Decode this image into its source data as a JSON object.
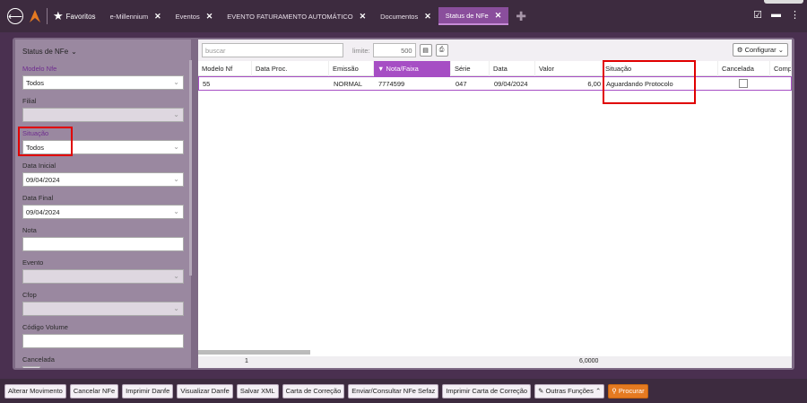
{
  "tabs": {
    "favoritos": "Favoritos",
    "items": [
      "e-Millennium",
      "Eventos",
      "EVENTO FATURAMENTO AUTOMÁTICO",
      "Documentos",
      "Status de NFe"
    ]
  },
  "side": {
    "title": "Status de NFe",
    "fields": [
      {
        "label": "Modelo Nfe",
        "value": "Todos"
      },
      {
        "label": "Filial",
        "value": ""
      },
      {
        "label": "Situação",
        "value": "Todos"
      },
      {
        "label": "Data Inicial",
        "value": "09/04/2024"
      },
      {
        "label": "Data Final",
        "value": "09/04/2024"
      },
      {
        "label": "Nota",
        "value": ""
      },
      {
        "label": "Evento",
        "value": ""
      },
      {
        "label": "Cfop",
        "value": ""
      },
      {
        "label": "Código Volume",
        "value": ""
      },
      {
        "label": "Cancelada",
        "value": ""
      }
    ]
  },
  "toolbar": {
    "search_placeholder": "buscar",
    "limit_label": "limite:",
    "limit_value": "500",
    "config": "Configurar"
  },
  "table": {
    "headers": [
      "Modelo Nf",
      "Data Proc.",
      "Emissão",
      "Nota/Faixa",
      "Série",
      "Data",
      "Valor",
      "Situação",
      "Cancelada",
      "Comp"
    ],
    "row": {
      "modelo": "55",
      "data_proc": "",
      "emissao": "NORMAL",
      "nota": "7774599",
      "serie": "047",
      "data": "09/04/2024",
      "valor": "6,00",
      "situacao": "Aguardando Protocolo"
    },
    "footer_count": "1",
    "footer_total": "6,0000"
  },
  "buttons": [
    "Alterar Movimento",
    "Cancelar NFe",
    "Imprimir Danfe",
    "Visualizar Danfe",
    "Salvar XML",
    "Carta de Correção",
    "Enviar/Consultar NFe Sefaz",
    "Imprimir Carta de Correção",
    "Outras Funções",
    "Procurar"
  ],
  "colors": {
    "accent": "#a64ec4",
    "highlight": "#e00000",
    "orange": "#e57a21"
  }
}
